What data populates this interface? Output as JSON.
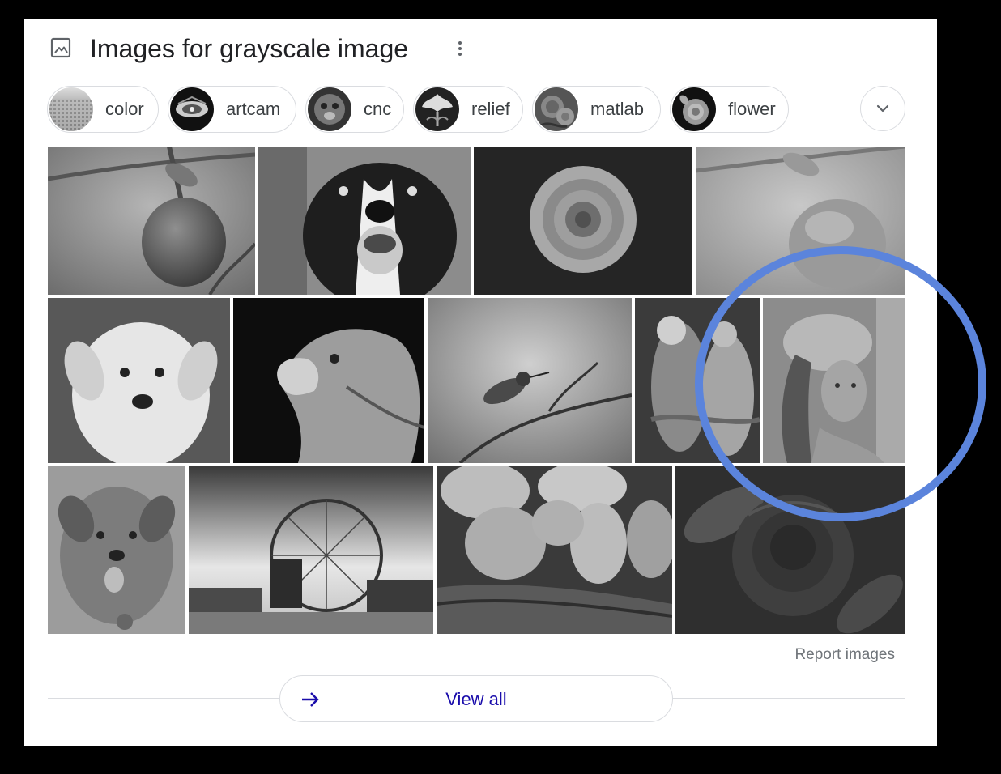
{
  "header": {
    "title": "Images for grayscale image",
    "icon": "image-icon",
    "menu_icon": "more-vert-icon"
  },
  "chips": [
    {
      "label": "color",
      "icon": "color-thumbnail"
    },
    {
      "label": "artcam",
      "icon": "artcam-thumbnail"
    },
    {
      "label": "cnc",
      "icon": "cnc-thumbnail"
    },
    {
      "label": "relief",
      "icon": "relief-thumbnail"
    },
    {
      "label": "matlab",
      "icon": "matlab-thumbnail"
    },
    {
      "label": "flower",
      "icon": "flower-thumbnail"
    }
  ],
  "expand_icon": "chevron-down-icon",
  "images": [
    "apple",
    "dog",
    "rose",
    "apple-inverted",
    "puppy",
    "eagle",
    "hummingbird",
    "parrots",
    "woman-in-hat",
    "puppy-tongue",
    "ferris-wheel",
    "potatoes",
    "dark-rose"
  ],
  "footer": {
    "report_label": "Report images",
    "view_all_label": "View all",
    "view_all_icon": "arrow-right-icon"
  },
  "annotation": {
    "shape": "circle",
    "color": "#5b84dc"
  }
}
